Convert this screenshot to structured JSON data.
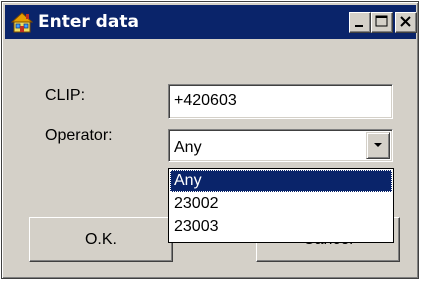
{
  "window": {
    "title": "Enter data",
    "titlebar_color": "#0a246a",
    "face_color": "#d4d0c8",
    "icon": "house-icon",
    "controls": [
      "minimize-icon",
      "maximize-icon",
      "close-icon"
    ]
  },
  "form": {
    "clip_label": "CLIP:",
    "clip_value": "+420603",
    "operator_label": "Operator:",
    "operator_selected": "Any"
  },
  "dropdown": {
    "options": [
      "Any",
      "23002",
      "23003"
    ],
    "highlighted": "Any"
  },
  "buttons": {
    "ok_label": "O.K.",
    "cancel_label": "Cancel"
  }
}
